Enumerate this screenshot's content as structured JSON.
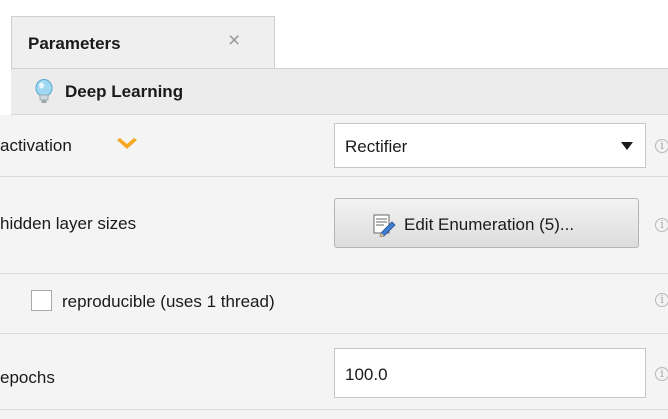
{
  "tab": {
    "title": "Parameters",
    "close_glyph": "×"
  },
  "section": {
    "title": "Deep Learning",
    "icon": "lightbulb-icon"
  },
  "params": {
    "activation": {
      "label": "activation",
      "value": "Rectifier",
      "icon": "chevron-down-icon"
    },
    "hidden_layer_sizes": {
      "label": "hidden layer sizes",
      "button_label": "Edit Enumeration (5)...",
      "icon": "edit-list-icon"
    },
    "reproducible": {
      "label": "reproducible (uses 1 thread)",
      "checked": false
    },
    "epochs": {
      "label": "epochs",
      "value": "100.0"
    }
  },
  "info_glyph": "i",
  "colors": {
    "accent_chevron": "#f5a623",
    "panel_bg": "#f4f4f4",
    "tab_bg": "#efefef"
  }
}
